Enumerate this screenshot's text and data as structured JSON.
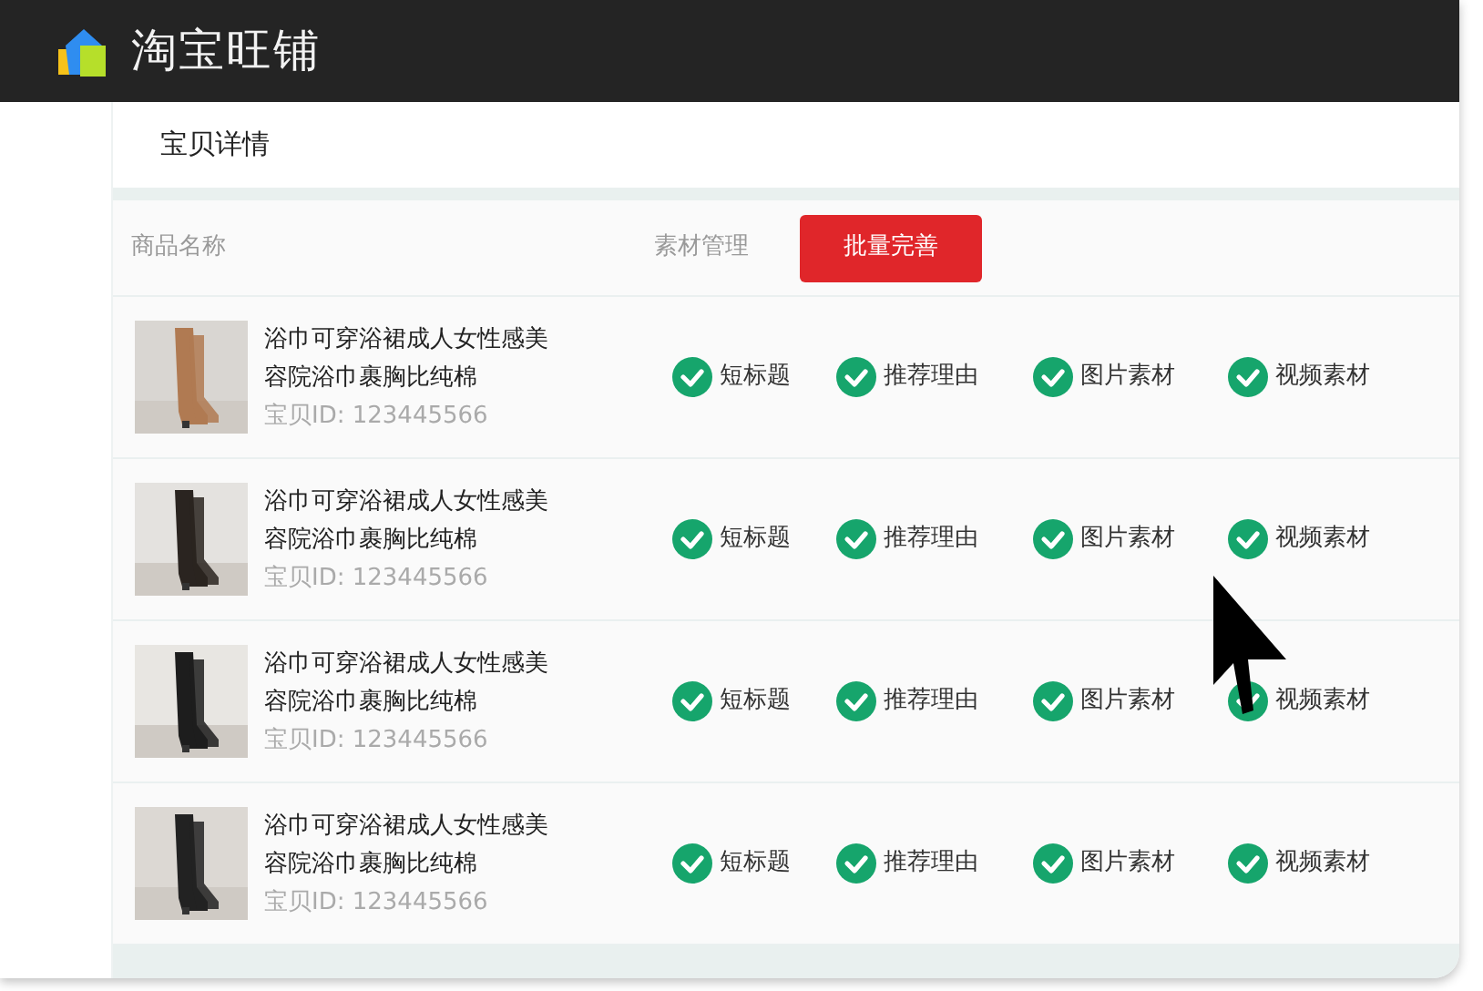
{
  "header": {
    "title": "淘宝旺铺"
  },
  "page_title": "宝贝详情",
  "table": {
    "columns": [
      "商品名称",
      "素材管理"
    ],
    "action_button": "批量完善",
    "rows": [
      {
        "name": "浴巾可穿浴裙成人女性感美容院浴巾裹胸比纯棉",
        "item_id": "宝贝ID: 123445566",
        "materials": [
          {
            "label": "短标题",
            "checked": true
          },
          {
            "label": "推荐理由",
            "checked": true
          },
          {
            "label": "图片素材",
            "checked": true
          },
          {
            "label": "视频素材",
            "checked": true
          }
        ]
      },
      {
        "name": "浴巾可穿浴裙成人女性感美容院浴巾裹胸比纯棉",
        "item_id": "宝贝ID: 123445566",
        "materials": [
          {
            "label": "短标题",
            "checked": true
          },
          {
            "label": "推荐理由",
            "checked": true
          },
          {
            "label": "图片素材",
            "checked": true
          },
          {
            "label": "视频素材",
            "checked": true
          }
        ]
      },
      {
        "name": "浴巾可穿浴裙成人女性感美容院浴巾裹胸比纯棉",
        "item_id": "宝贝ID: 123445566",
        "materials": [
          {
            "label": "短标题",
            "checked": true
          },
          {
            "label": "推荐理由",
            "checked": true
          },
          {
            "label": "图片素材",
            "checked": true
          },
          {
            "label": "视频素材",
            "checked": true
          }
        ]
      },
      {
        "name": "浴巾可穿浴裙成人女性感美容院浴巾裹胸比纯棉",
        "item_id": "宝贝ID: 123445566",
        "materials": [
          {
            "label": "短标题",
            "checked": true
          },
          {
            "label": "推荐理由",
            "checked": true
          },
          {
            "label": "图片素材",
            "checked": true
          },
          {
            "label": "视频素材",
            "checked": true
          }
        ]
      }
    ]
  }
}
